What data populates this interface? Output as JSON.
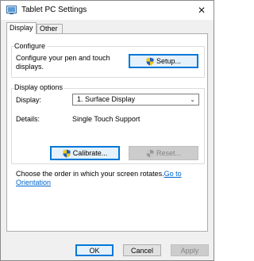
{
  "window": {
    "title": "Tablet PC Settings",
    "close_glyph": "✕",
    "app_icon": "tablet-icon"
  },
  "tabs": [
    {
      "label": "Display",
      "active": true
    },
    {
      "label": "Other",
      "active": false
    }
  ],
  "configure": {
    "group_title": "Configure",
    "description": "Configure your pen and touch displays.",
    "setup_label": "Setup..."
  },
  "display_options": {
    "group_title": "Display options",
    "display_label": "Display:",
    "display_value": "1. Surface Display",
    "details_label": "Details:",
    "details_value": "Single Touch Support",
    "calibrate_label": "Calibrate...",
    "reset_label": "Reset..."
  },
  "orientation": {
    "text": "Choose the order in which your screen rotates.",
    "link_part1": "Go to",
    "link_part2": "Orientation"
  },
  "footer": {
    "ok_label": "OK",
    "cancel_label": "Cancel",
    "apply_label": "Apply"
  },
  "colors": {
    "accent": "#0078d7",
    "link": "#0066cc",
    "shield_blue": "#1f5fbf",
    "shield_yellow": "#f2c811"
  }
}
